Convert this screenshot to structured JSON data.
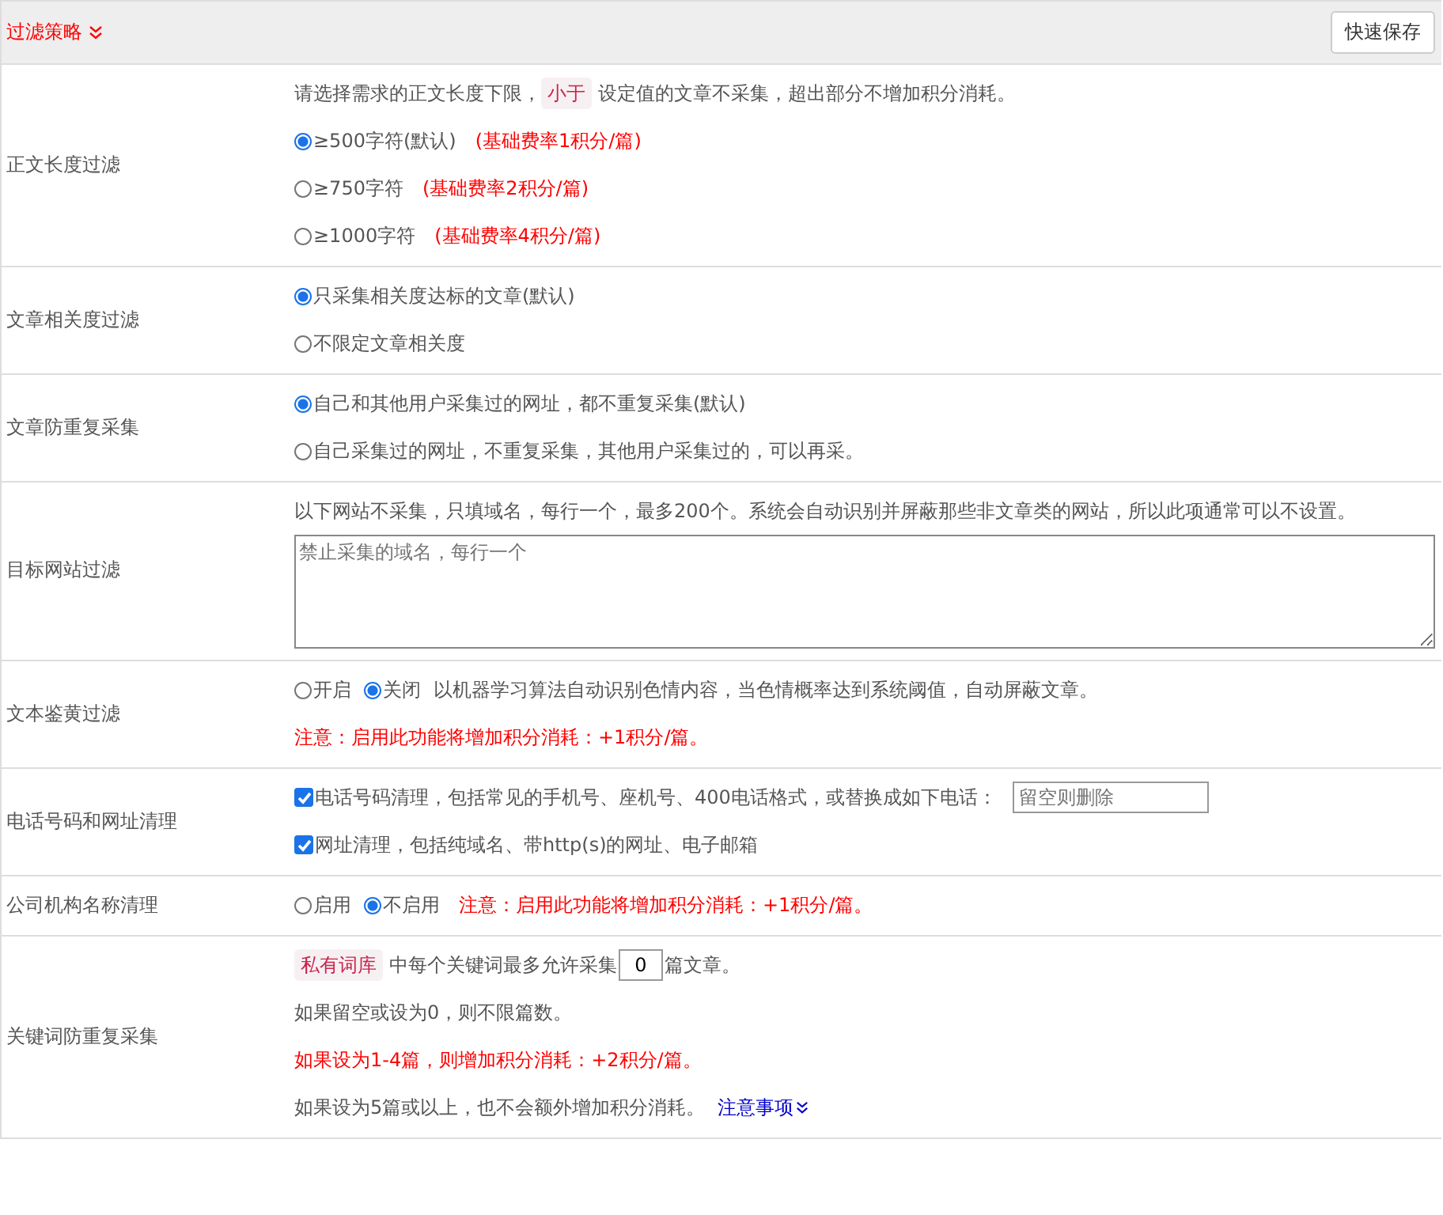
{
  "header": {
    "title": "过滤策略",
    "expanded": true,
    "save_button": "快速保存"
  },
  "rows": [
    {
      "label": "正文长度过滤",
      "lines": [
        [
          {
            "kind": "text",
            "text": "请选择需求的正文长度下限，"
          },
          {
            "kind": "tag",
            "text": "小于"
          },
          {
            "kind": "text",
            "text": "设定值的文章不采集，超出部分不增加积分消耗。"
          }
        ],
        [
          {
            "kind": "radio",
            "text": "≥500字符(默认)",
            "selected": true
          },
          {
            "kind": "note",
            "text": "(基础费率1积分/篇)"
          }
        ],
        [
          {
            "kind": "radio",
            "text": "≥750字符",
            "selected": false
          },
          {
            "kind": "note",
            "text": "(基础费率2积分/篇)"
          }
        ],
        [
          {
            "kind": "radio",
            "text": "≥1000字符",
            "selected": false
          },
          {
            "kind": "note",
            "text": "(基础费率4积分/篇)"
          }
        ]
      ]
    },
    {
      "label": "文章相关度过滤",
      "lines": [
        [
          {
            "kind": "radio",
            "text": "只采集相关度达标的文章(默认)",
            "selected": true
          }
        ],
        [
          {
            "kind": "radio",
            "text": "不限定文章相关度",
            "selected": false
          }
        ]
      ]
    },
    {
      "label": "文章防重复采集",
      "lines": [
        [
          {
            "kind": "radio",
            "text": "自己和其他用户采集过的网址，都不重复采集(默认)",
            "selected": true
          }
        ],
        [
          {
            "kind": "radio",
            "text": "自己采集过的网址，不重复采集，其他用户采集过的，可以再采。",
            "selected": false
          }
        ]
      ]
    },
    {
      "label": "目标网站过滤",
      "lines": [
        [
          {
            "kind": "text",
            "text": "以下网站不采集，只填域名，每行一个，最多200个。系统会自动识别并屏蔽那些非文章类的网站，所以此项通常可以不设置。"
          }
        ],
        [
          {
            "kind": "textarea",
            "placeholder": "禁止采集的域名，每行一个"
          }
        ]
      ]
    },
    {
      "label": "文本鉴黄过滤",
      "lines": [
        [
          {
            "kind": "radio",
            "text": "开启",
            "selected": false
          },
          {
            "kind": "radio",
            "text": "关闭",
            "selected": true
          },
          {
            "kind": "text",
            "text": "以机器学习算法自动识别色情内容，当色情概率达到系统阈值，自动屏蔽文章。"
          }
        ],
        [
          {
            "kind": "note",
            "text": "注意：启用此功能将增加积分消耗：+1积分/篇。"
          }
        ]
      ]
    },
    {
      "label": "电话号码和网址清理",
      "lines": [
        [
          {
            "kind": "checkbox",
            "text": "电话号码清理，包括常见的手机号、座机号、400电话格式，或替换成如下电话：",
            "checked": true
          },
          {
            "kind": "input",
            "placeholder": "留空则删除"
          }
        ],
        [
          {
            "kind": "checkbox",
            "text": "网址清理，包括纯域名、带http(s)的网址、电子邮箱",
            "checked": true
          }
        ]
      ]
    },
    {
      "label": "公司机构名称清理",
      "lines": [
        [
          {
            "kind": "radio",
            "text": "启用",
            "selected": false
          },
          {
            "kind": "radio",
            "text": "不启用",
            "selected": true
          },
          {
            "kind": "note",
            "text": "注意：启用此功能将增加积分消耗：+1积分/篇。"
          }
        ]
      ]
    },
    {
      "label": "关键词防重复采集",
      "lines": [
        [
          {
            "kind": "tag",
            "text": "私有词库"
          },
          {
            "kind": "text",
            "text": "中每个关键词最多允许采集"
          },
          {
            "kind": "number",
            "value": "0"
          },
          {
            "kind": "text",
            "text": "篇文章。"
          }
        ],
        [
          {
            "kind": "text",
            "text": "如果留空或设为0，则不限篇数。"
          }
        ],
        [
          {
            "kind": "note",
            "text": "如果设为1-4篇，则增加积分消耗：+2积分/篇。"
          }
        ],
        [
          {
            "kind": "text",
            "text": "如果设为5篇或以上，也不会额外增加积分消耗。"
          },
          {
            "kind": "link",
            "text": "注意事项"
          }
        ]
      ]
    }
  ]
}
